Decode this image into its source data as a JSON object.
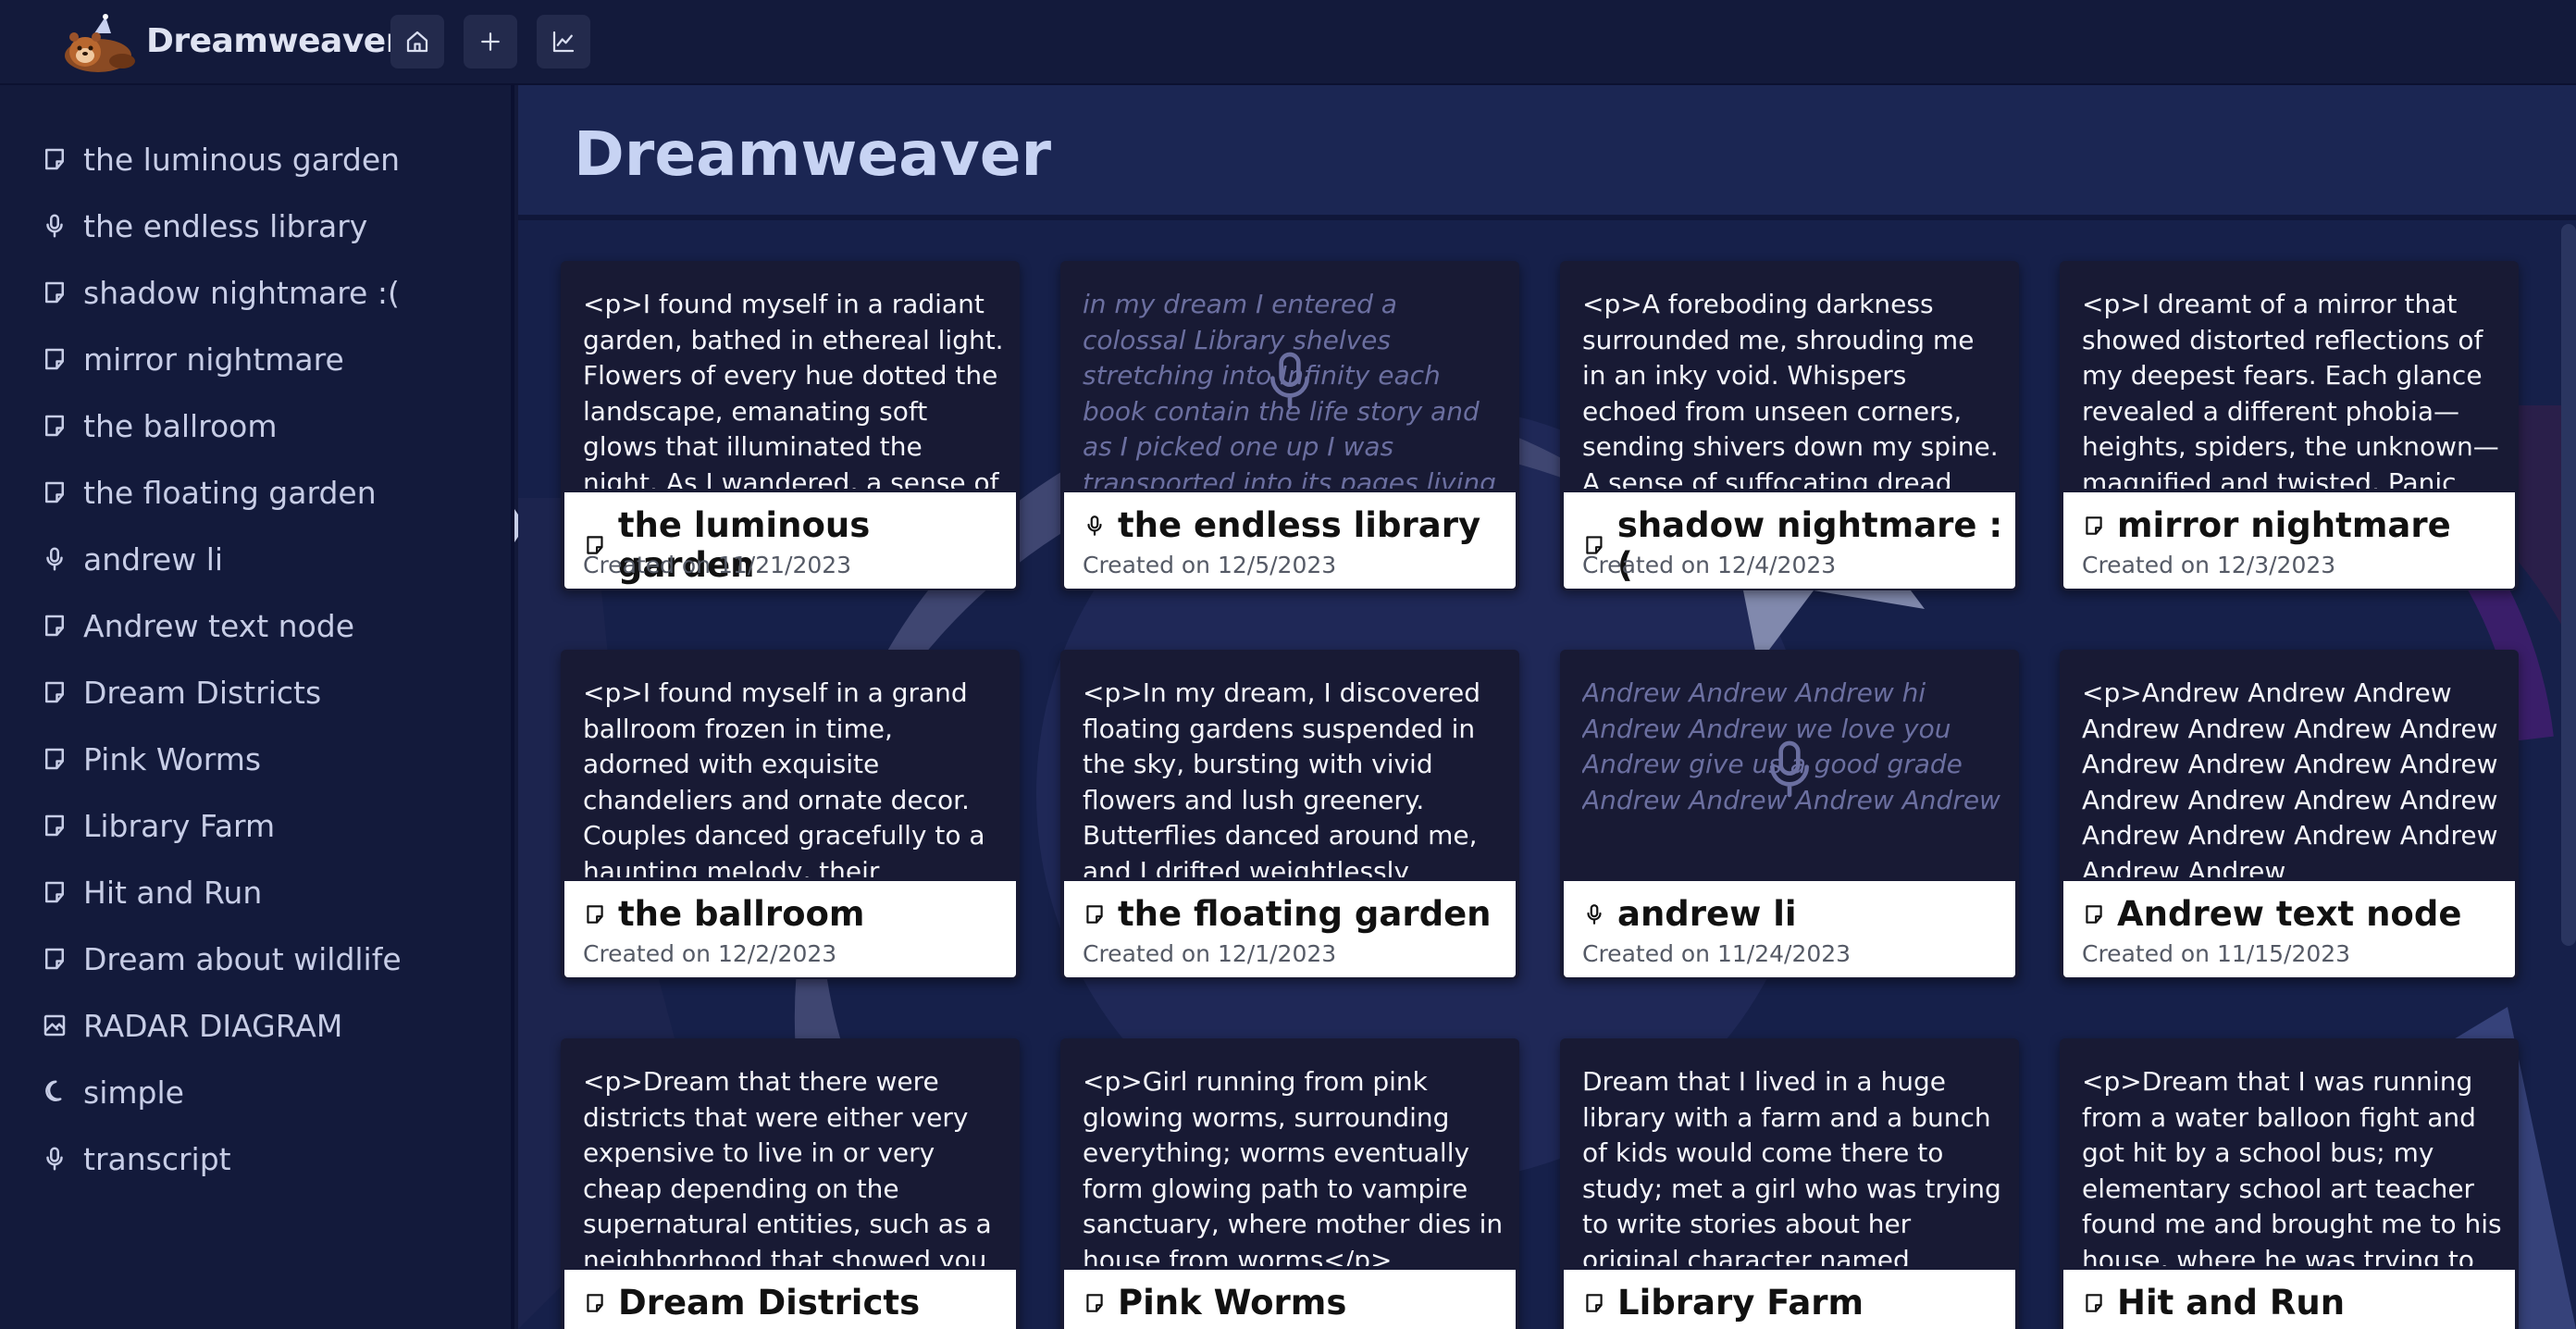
{
  "app": {
    "name": "Dreamweaver"
  },
  "topbar": {
    "buttons": [
      {
        "icon": "home-icon"
      },
      {
        "icon": "plus-icon"
      },
      {
        "icon": "chart-icon"
      }
    ]
  },
  "sidebar": {
    "items": [
      {
        "label": "the luminous garden",
        "icon": "note-icon"
      },
      {
        "label": "the endless library",
        "icon": "mic-icon"
      },
      {
        "label": "shadow nightmare :(",
        "icon": "note-icon"
      },
      {
        "label": "mirror nightmare",
        "icon": "note-icon"
      },
      {
        "label": "the ballroom",
        "icon": "note-icon"
      },
      {
        "label": "the floating garden",
        "icon": "note-icon"
      },
      {
        "label": "andrew li",
        "icon": "mic-icon"
      },
      {
        "label": "Andrew text node",
        "icon": "note-icon"
      },
      {
        "label": "Dream Districts",
        "icon": "note-icon"
      },
      {
        "label": "Pink Worms",
        "icon": "note-icon"
      },
      {
        "label": "Library Farm",
        "icon": "note-icon"
      },
      {
        "label": "Hit and Run",
        "icon": "note-icon"
      },
      {
        "label": "Dream about wildlife",
        "icon": "note-icon"
      },
      {
        "label": "RADAR DIAGRAM",
        "icon": "image-icon"
      },
      {
        "label": "simple",
        "icon": "moon-icon"
      },
      {
        "label": "transcript",
        "icon": "mic-icon"
      }
    ]
  },
  "main": {
    "title": "Dreamweaver",
    "cards": [
      {
        "title": "the luminous garden",
        "type": "note",
        "date": "Created on 11/21/2023",
        "body": "<p>I found myself in a radiant garden, bathed in ethereal light. Flowers of every hue dotted the landscape, emanating soft glows that illuminated the night. As I wandered, a sense of tranquility"
      },
      {
        "title": "the endless library",
        "type": "audio",
        "date": "Created on 12/5/2023",
        "body": "in my dream I entered a colossal Library shelves stretching into Infinity each book contain the life story and as I picked one up I was transported into its pages living another person's existence"
      },
      {
        "title": "shadow nightmare :(",
        "type": "note",
        "date": "Created on 12/4/2023",
        "body": "<p>A foreboding darkness surrounded me, shrouding me in an inky void. Whispers echoed from unseen corners, sending shivers down my spine. A sense of suffocating dread gripped me"
      },
      {
        "title": "mirror nightmare",
        "type": "note",
        "date": "Created on 12/3/2023",
        "body": "<p>I dreamt of a mirror that showed distorted reflections of my deepest fears. Each glance revealed a different phobia—heights, spiders, the unknown—magnified and twisted. Panic"
      },
      {
        "title": "the ballroom",
        "type": "note",
        "date": "Created on 12/2/2023",
        "body": "<p>I found myself in a grand ballroom frozen in time, adorned with exquisite chandeliers and ornate decor. Couples danced gracefully to a haunting melody, their movements graceful yet"
      },
      {
        "title": "the floating garden",
        "type": "note",
        "date": "Created on 12/1/2023",
        "body": "<p>In my dream, I discovered floating gardens suspended in the sky, bursting with vivid flowers and lush greenery. Butterflies danced around me, and I drifted weightlessly among"
      },
      {
        "title": "andrew li",
        "type": "audio",
        "date": "Created on 11/24/2023",
        "body": "Andrew Andrew Andrew hi Andrew Andrew we love you Andrew give us a good grade Andrew Andrew Andrew Andrew"
      },
      {
        "title": "Andrew text node",
        "type": "note",
        "date": "Created on 11/15/2023",
        "body": "<p>Andrew Andrew Andrew Andrew Andrew Andrew Andrew Andrew Andrew Andrew Andrew Andrew Andrew Andrew Andrew Andrew Andrew Andrew Andrew Andrew Andrew"
      },
      {
        "title": "Dream Districts",
        "type": "note",
        "date": "",
        "body": "<p>Dream that there were districts that were either very expensive to live in or very cheap depending on the supernatural entities, such as a neighborhood that showed you alternate"
      },
      {
        "title": "Pink Worms",
        "type": "note",
        "date": "",
        "body": "<p>Girl running from pink glowing worms, surrounding everything; worms eventually form glowing path to vampire sanctuary, where mother dies in house from worms</p>"
      },
      {
        "title": "Library Farm",
        "type": "note",
        "date": "",
        "body": "Dream that I lived in a huge library with a farm and a bunch of kids would come there to study; met a girl who was trying to write stories about her original character named \"Sandwich Clip"
      },
      {
        "title": "Hit and Run",
        "type": "note",
        "date": "",
        "body": "<p>Dream that I was running from a water balloon fight and got hit by a school bus; my elementary school art teacher found me and brought me to his house, where he was trying to fill"
      }
    ]
  }
}
